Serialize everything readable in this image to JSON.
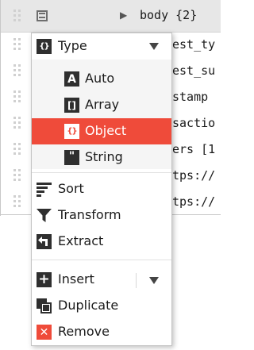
{
  "editor": {
    "header": {
      "expand_arrow": "▶",
      "body_text": "body {2}"
    },
    "rows": [
      "est_ty",
      "est_su",
      "stamp",
      "sactio",
      "ers [1",
      "tps://",
      "tps://"
    ]
  },
  "menu": {
    "type": {
      "label": "Type",
      "icon_text": "{}",
      "options": [
        {
          "label": "Auto",
          "icon_text": "A"
        },
        {
          "label": "Array",
          "icon_text": "[]"
        },
        {
          "label": "Object",
          "icon_text": "{}"
        },
        {
          "label": "String",
          "icon_text": "\""
        }
      ],
      "selected": "Object"
    },
    "sort": "Sort",
    "transform": "Transform",
    "extract": "Extract",
    "insert": "Insert",
    "insert_icon": "+",
    "duplicate": "Duplicate",
    "remove": "Remove",
    "remove_icon": "✕"
  },
  "colors": {
    "accent": "#ef4b3a",
    "icon_dark": "#2f2f2f",
    "header_bg": "#e7e7e7"
  }
}
